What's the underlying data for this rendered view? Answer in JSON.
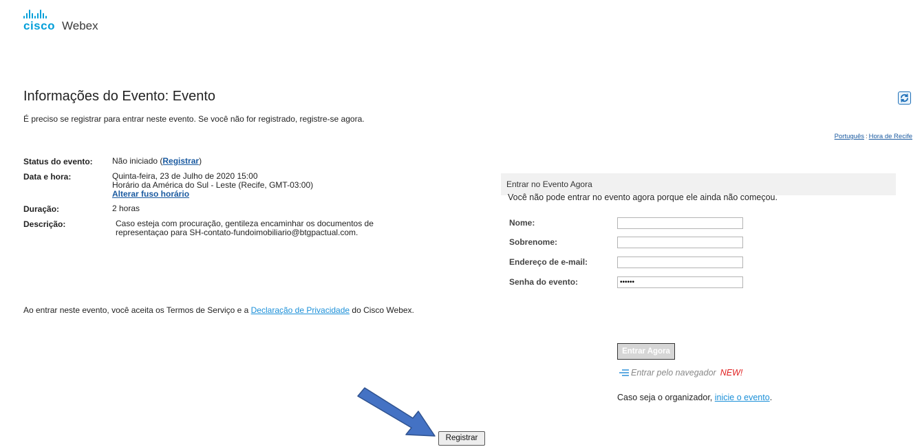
{
  "brand": {
    "logo_word": "cisco",
    "product": "Webex",
    "accent_color": "#049fd9"
  },
  "header": {
    "title": "Informações do Evento: Evento",
    "register_note": "É preciso se registrar para entrar neste evento. Se você não for registrado, registre-se agora.",
    "refresh_icon": "refresh-icon"
  },
  "top_links": {
    "language": "Português",
    "separator": ":",
    "timezone": "Hora de Recife"
  },
  "event_info": {
    "status_label": "Status do evento:",
    "status_value": "Não iniciado (",
    "status_link": "Registrar",
    "status_close": ")",
    "date_label": "Data e hora:",
    "date_line1": "Quinta-feira, 23 de Julho de 2020 15:00",
    "date_line2": "Horário da América do Sul - Leste (Recife, GMT-03:00)",
    "date_link": "Alterar fuso horário",
    "duration_label": "Duração:",
    "duration_value": "2 horas",
    "description_label": "Descrição:",
    "description_line1": "Caso esteja com procuração, gentileza encaminhar os documentos de",
    "description_line2": "representaçao para SH-contato-fundoimobiliario@btgpactual.com."
  },
  "terms": {
    "prefix": "Ao entrar neste evento, você aceita os Termos de Serviço e a ",
    "privacy_link": "Declaração de Privacidade",
    "suffix": " do Cisco Webex."
  },
  "join_panel": {
    "header": "Entrar no Evento Agora",
    "message": "Você não pode entrar no evento agora porque ele ainda não começou.",
    "fields": {
      "name_label": "Nome:",
      "name_value": "",
      "surname_label": "Sobrenome:",
      "surname_value": "",
      "email_label": "Endereço de e-mail:",
      "email_value": "",
      "password_label": "Senha do evento:",
      "password_value": "••••••"
    },
    "enter_button": "Entrar Agora",
    "browser_link": "Entrar pelo navegador",
    "browser_new": "NEW!",
    "organizer_prefix": "Caso seja o organizador, ",
    "organizer_link": "inicie o evento",
    "organizer_suffix": "."
  },
  "register_button": "Registrar",
  "colors": {
    "link": "#1a5aa0",
    "link_light": "#1a8fd8",
    "arrow_fill": "#4472c4",
    "arrow_stroke": "#2f528f",
    "new_badge": "#e02020"
  }
}
